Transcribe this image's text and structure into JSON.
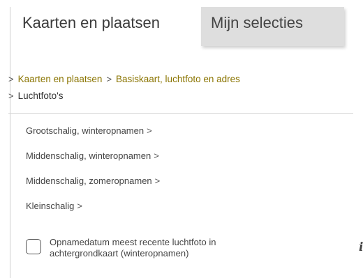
{
  "tabs": [
    {
      "label": "Kaarten en plaatsen",
      "active": true
    },
    {
      "label": "Mijn selecties",
      "active": false
    }
  ],
  "breadcrumb": {
    "separator": ">",
    "links": [
      "Kaarten en plaatsen",
      "Basiskaart, luchtfoto en adres"
    ],
    "current": "Luchtfoto's"
  },
  "items": [
    {
      "label": "Grootschalig, winteropnamen",
      "chevron": ">"
    },
    {
      "label": "Middenschalig, winteropnamen",
      "chevron": ">"
    },
    {
      "label": "Middenschalig, zomeropnamen",
      "chevron": ">"
    },
    {
      "label": "Kleinschalig",
      "chevron": ">"
    }
  ],
  "checkbox": {
    "label_line1": "Opnamedatum meest recente luchtfoto in",
    "label_line2": "achtergrondkaart (winteropnamen)",
    "checked": false
  },
  "info_icon": {
    "glyph": "i",
    "name": "info-icon"
  },
  "colors": {
    "link": "#8a7400",
    "tab_inactive_bg": "#dedede",
    "divider": "#d6d6d6"
  }
}
